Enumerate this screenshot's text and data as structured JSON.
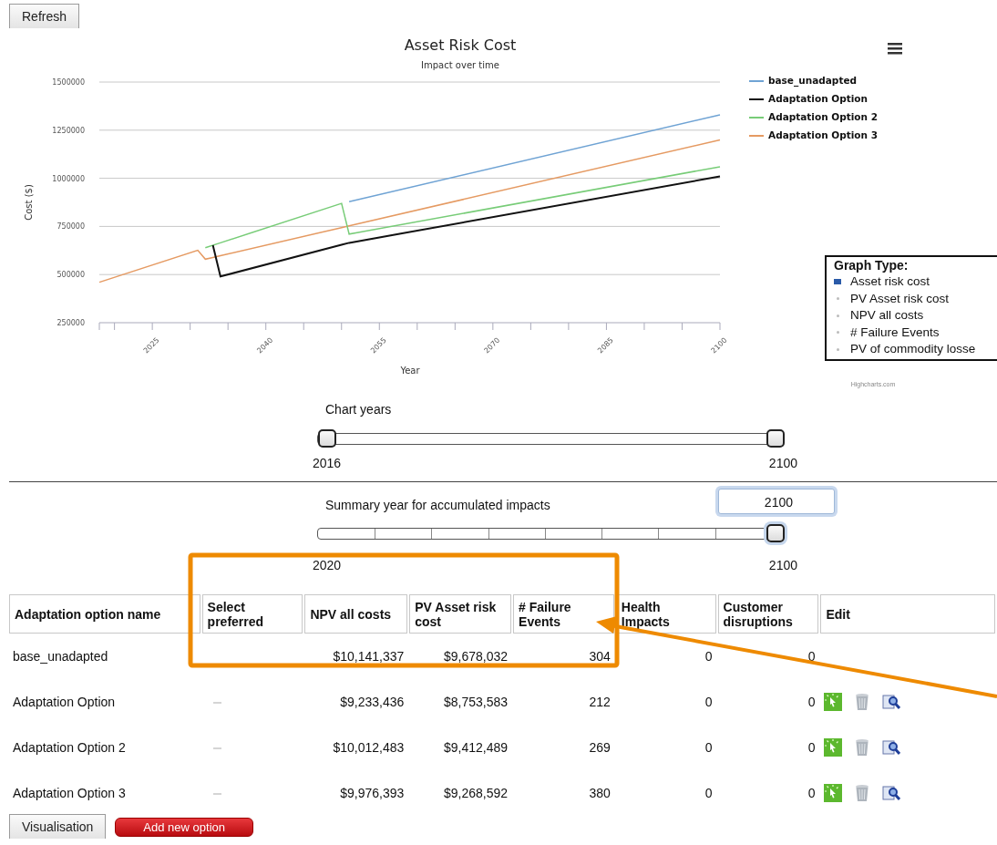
{
  "toolbar": {
    "refresh_button": "Refresh"
  },
  "chart": {
    "subtitle": "Impact over time",
    "credit": "Highcharts.com",
    "chart_data": {
      "type": "line",
      "title": "Asset Risk Cost",
      "xlabel": "Year",
      "ylabel": "Cost ($)",
      "x": [
        2018,
        2031,
        2032,
        2033,
        2034,
        2050,
        2051,
        2100
      ],
      "series": [
        {
          "name": "base_unadapted",
          "color": "#6fa3d4",
          "values": [
            null,
            null,
            null,
            null,
            null,
            null,
            879000,
            1330000
          ]
        },
        {
          "name": "Adaptation Option",
          "color": "#111111",
          "values": [
            null,
            null,
            null,
            652000,
            490000,
            655000,
            665000,
            1010000
          ]
        },
        {
          "name": "Adaptation Option 2",
          "color": "#77cc77",
          "values": [
            null,
            null,
            639000,
            null,
            665000,
            870000,
            710000,
            1060000
          ]
        },
        {
          "name": "Adaptation Option 3",
          "color": "#e59a62",
          "values": [
            460000,
            626000,
            580000,
            589000,
            598000,
            744000,
            753000,
            1200000
          ]
        }
      ],
      "xlim": [
        2018,
        2100
      ],
      "grid": true,
      "legend": "right",
      "ylim": [
        250000,
        1500000
      ],
      "xticks": [
        2025,
        2040,
        2055,
        2070,
        2085,
        2100
      ],
      "yticks": [
        250000,
        500000,
        750000,
        1000000,
        1250000,
        1500000
      ]
    }
  },
  "graph_type": {
    "title": "Graph Type:",
    "options": [
      {
        "label": "Asset risk cost",
        "selected": true
      },
      {
        "label": "PV Asset risk cost",
        "selected": false
      },
      {
        "label": "NPV all costs",
        "selected": false
      },
      {
        "label": "# Failure Events",
        "selected": false
      },
      {
        "label": "PV of commodity losse",
        "selected": false
      }
    ]
  },
  "chart_years": {
    "label": "Chart years",
    "handles": [
      {
        "level": 0
      },
      {
        "level": 1
      }
    ],
    "min_label": "2016",
    "max_label": "2100"
  },
  "summary_year": {
    "label": "Summary year for accumulated impacts",
    "level": 1,
    "tooltip": "2100",
    "min_label": "2020",
    "max_label": "2100"
  },
  "table": {
    "columns": [
      "Adaptation option name",
      "Select preferred",
      "NPV all costs",
      "PV Asset risk cost",
      "# Failure Events",
      "Health Impacts",
      "Customer disruptions",
      "Edit"
    ],
    "rows": [
      {
        "name": "base_unadapted",
        "npv": "$10,141,337",
        "pv": "$9,678,032",
        "failures": "304",
        "health": "0",
        "customer": "0",
        "editable": false
      },
      {
        "name": "Adaptation Option",
        "preferred": false,
        "npv": "$9,233,436",
        "pv": "$8,753,583",
        "failures": "212",
        "health": "0",
        "customer": "0",
        "editable": true
      },
      {
        "name": "Adaptation Option 2",
        "preferred": false,
        "npv": "$10,012,483",
        "pv": "$9,412,489",
        "failures": "269",
        "health": "0",
        "customer": "0",
        "editable": true
      },
      {
        "name": "Adaptation Option 3",
        "preferred": false,
        "npv": "$9,976,393",
        "pv": "$9,268,592",
        "failures": "380",
        "health": "0",
        "customer": "0",
        "editable": true
      }
    ]
  },
  "buttons": [
    {
      "label": "Visualisation",
      "kind": "tab"
    },
    {
      "label": "Add new option",
      "kind": "primary"
    }
  ]
}
